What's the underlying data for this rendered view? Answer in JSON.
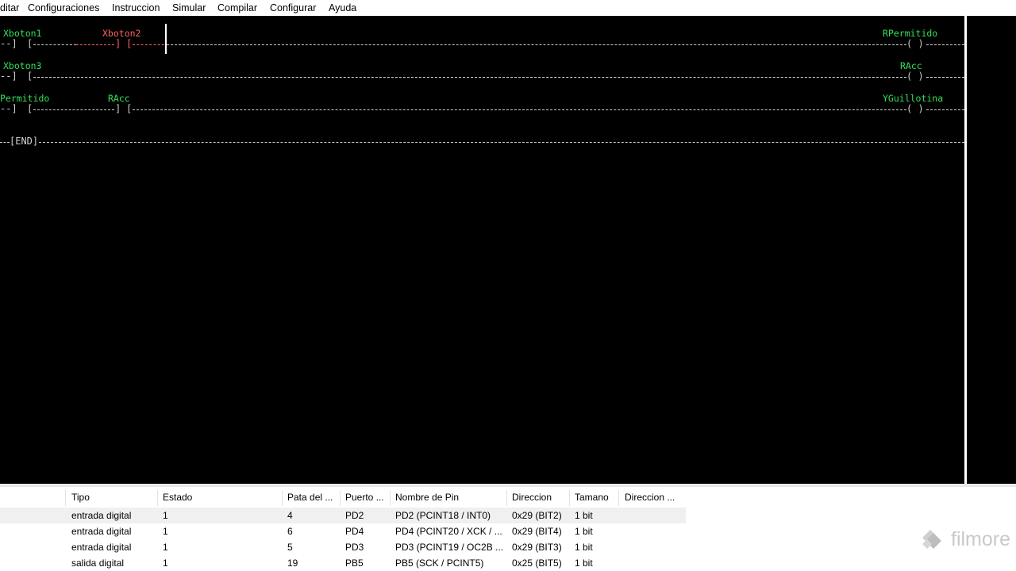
{
  "menu": {
    "items": [
      "ditar",
      "Configuraciones",
      "Instruccion",
      "Simular",
      "Compilar",
      "Configurar",
      "Ayuda"
    ]
  },
  "ladder": {
    "rungs": [
      {
        "contacts": [
          "Xboton1",
          "Xboton2"
        ],
        "coil": "RPermitido"
      },
      {
        "contacts": [
          "Xboton3"
        ],
        "coil": "RAcc"
      },
      {
        "contacts": [
          "Permitido",
          "RAcc"
        ],
        "coil": "YGuillotina"
      }
    ],
    "end_label": "[END]",
    "contact_symbol": "] [",
    "coil_symbol": "( )",
    "rail_stub": "--]"
  },
  "io_table": {
    "columns": [
      "Tipo",
      "Estado",
      "Pata del ...",
      "Puerto ...",
      "Nombre de Pin",
      "Direccion",
      "Tamano",
      "Direccion ..."
    ],
    "rows": [
      [
        "entrada digital",
        "1",
        "4",
        "PD2",
        "PD2 (PCINT18 / INT0)",
        "0x29 (BIT2)",
        "1 bit",
        ""
      ],
      [
        "entrada digital",
        "1",
        "6",
        "PD4",
        "PD4 (PCINT20 / XCK / ...",
        "0x29 (BIT4)",
        "1 bit",
        ""
      ],
      [
        "entrada digital",
        "1",
        "5",
        "PD3",
        "PD3 (PCINT19 / OC2B ...",
        "0x29 (BIT3)",
        "1 bit",
        ""
      ],
      [
        "salida digital",
        "1",
        "19",
        "PB5",
        "PB5 (SCK / PCINT5)",
        "0x25 (BIT5)",
        "1 bit",
        ""
      ]
    ]
  },
  "watermark": {
    "text": "filmore"
  },
  "colors": {
    "background": "#000000",
    "contact_label": "#33e05a",
    "selected": "#ff6262",
    "wire": "#cfcfcf"
  }
}
